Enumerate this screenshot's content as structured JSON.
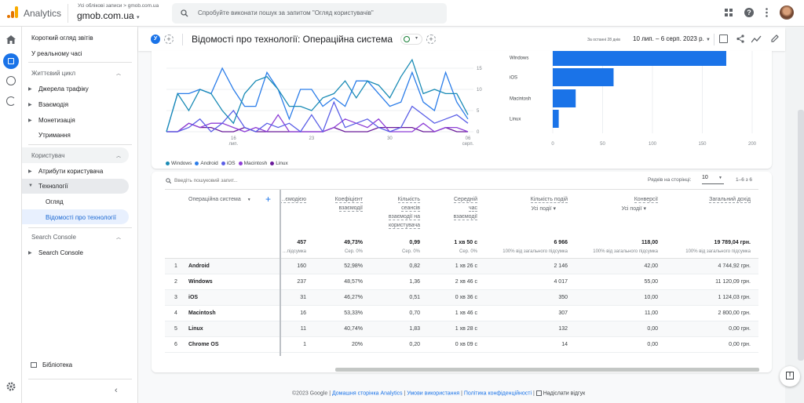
{
  "header": {
    "app_name": "Analytics",
    "breadcrumb": "Усі облікові записи > gmob.com.ua",
    "property": "gmob.com.ua",
    "search_placeholder": "Спробуйте виконати пошук за запитом \"Огляд користувачів\"",
    "icons": [
      "apps-icon",
      "help-icon",
      "more-vert-icon",
      "avatar"
    ]
  },
  "sidebar": {
    "top_items": [
      "Короткий огляд звітів",
      "У реальному часі"
    ],
    "sections": [
      {
        "title": "Життєвий цикл",
        "items": [
          {
            "label": "Джерела трафіку",
            "expandable": true
          },
          {
            "label": "Взаємодія",
            "expandable": true
          },
          {
            "label": "Монетизація",
            "expandable": true
          },
          {
            "label": "Утримання",
            "expandable": false
          }
        ]
      },
      {
        "title": "Користувач",
        "items": [
          {
            "label": "Атрибути користувача",
            "expandable": true
          },
          {
            "label": "Технології",
            "expanded": true
          },
          {
            "label": "Огляд",
            "child": true
          },
          {
            "label": "Відомості про технології",
            "child": true,
            "active": true
          }
        ]
      },
      {
        "title": "Search Console",
        "items": [
          {
            "label": "Search Console",
            "expandable": true
          }
        ]
      }
    ],
    "library": "Бібліотека"
  },
  "report": {
    "segment_badge": "У",
    "title": "Відомості про технології: Операційна система",
    "date_label": "За останні 28 днів",
    "date_range": "10 лип. – 6 серп. 2023 р."
  },
  "chart_data": [
    {
      "type": "line",
      "x": [
        "10.07",
        "11.07",
        "12.07",
        "13.07",
        "14.07",
        "15.07",
        "16.07",
        "17.07",
        "18.07",
        "19.07",
        "20.07",
        "21.07",
        "22.07",
        "23.07",
        "24.07",
        "25.07",
        "26.07",
        "27.07",
        "28.07",
        "29.07",
        "30.07",
        "31.07",
        "01.08",
        "02.08",
        "03.08",
        "04.08",
        "05.08",
        "06.08"
      ],
      "xticks": [
        {
          "label": "16",
          "sub": "лип.",
          "at": "16.07"
        },
        {
          "label": "23",
          "sub": "",
          "at": "23.07"
        },
        {
          "label": "30",
          "sub": "",
          "at": "30.07"
        },
        {
          "label": "06",
          "sub": "серп.",
          "at": "06.08"
        }
      ],
      "yticks": [
        0,
        5,
        10,
        15
      ],
      "ylim": [
        0,
        18
      ],
      "grid": true,
      "legend": "bottom",
      "series": [
        {
          "name": "Windows",
          "color": "#1a8bb5",
          "values": [
            0,
            9,
            5,
            10,
            9,
            5,
            2,
            9,
            12,
            13,
            10,
            6,
            6,
            5,
            8,
            9,
            12,
            8,
            12,
            11,
            8,
            13,
            17,
            9,
            10,
            9,
            9,
            4
          ]
        },
        {
          "name": "Android",
          "color": "#2b7de9",
          "values": [
            0,
            9,
            9,
            10,
            9,
            15,
            10,
            6,
            6,
            14,
            10,
            3,
            10,
            10,
            6,
            8,
            6,
            12,
            12,
            9,
            6,
            7,
            14,
            7,
            5,
            14,
            7,
            3
          ]
        },
        {
          "name": "iOS",
          "color": "#5a5ee6",
          "values": [
            0,
            0,
            1,
            3,
            0,
            2,
            5,
            1,
            0,
            2,
            1,
            2,
            0,
            4,
            0,
            7,
            1,
            2,
            3,
            1,
            0,
            1,
            6,
            4,
            2,
            3,
            4,
            2
          ]
        },
        {
          "name": "Macintosh",
          "color": "#8e3fd6",
          "values": [
            0,
            0,
            2,
            1,
            2,
            2,
            1,
            0,
            1,
            0,
            4,
            0,
            0,
            0,
            0,
            1,
            3,
            2,
            1,
            3,
            0,
            0,
            0,
            2,
            0,
            1,
            1,
            0
          ]
        },
        {
          "name": "Linux",
          "color": "#6a1b9a",
          "values": [
            0,
            0,
            2,
            1,
            1,
            0,
            0,
            1,
            0,
            0,
            0,
            0,
            0,
            0,
            0,
            1,
            0,
            0,
            0,
            1,
            1,
            1,
            1,
            0,
            0,
            1,
            0,
            0
          ]
        }
      ]
    },
    {
      "type": "bar",
      "orientation": "horizontal",
      "categories": [
        "Windows",
        "iOS",
        "Macintosh",
        "Linux"
      ],
      "values": [
        174,
        61,
        23,
        6
      ],
      "xticks": [
        0,
        50,
        100,
        150,
        200
      ],
      "xlim": [
        0,
        200
      ],
      "color": "#1a73e8",
      "grid": true
    }
  ],
  "table": {
    "search_placeholder": "Введіть пошуковий запит...",
    "rows_per_page_label": "Рядків на сторінці:",
    "rows_per_page": "10",
    "pagination": "1–6 з 6",
    "dimension_header": "Операційна система",
    "columns": [
      {
        "lines": [
          "…ємодією"
        ]
      },
      {
        "lines": [
          "Коефіцієнт",
          "взаємодії"
        ]
      },
      {
        "lines": [
          "Кількість",
          "сеансів",
          "взаємодії на",
          "користувача"
        ]
      },
      {
        "lines": [
          "Середній",
          "час",
          "взаємодії"
        ]
      },
      {
        "lines": [
          "Кількість подій"
        ],
        "select": "Усі події"
      },
      {
        "lines": [
          "Конверсії"
        ],
        "select": "Усі події"
      },
      {
        "lines": [
          "Загальний дохід"
        ]
      }
    ],
    "totals": [
      "457",
      "49,73%",
      "0,99",
      "1 хв 50 с",
      "6 966",
      "118,00",
      "19 789,04 грн."
    ],
    "totals_sub": [
      "…підсумка",
      "Сер. 0%",
      "Сер. 0%",
      "Сер. 0%",
      "100% від загального підсумка",
      "100% від загального підсумка",
      "100% від загального підсумка"
    ],
    "rows": [
      {
        "rank": "1",
        "name": "Android",
        "values": [
          "160",
          "52,98%",
          "0,82",
          "1 хв 26 с",
          "2 146",
          "42,00",
          "4 744,92 грн."
        ]
      },
      {
        "rank": "2",
        "name": "Windows",
        "values": [
          "237",
          "48,57%",
          "1,36",
          "2 хв 46 с",
          "4 017",
          "55,00",
          "11 120,09 грн."
        ]
      },
      {
        "rank": "3",
        "name": "iOS",
        "values": [
          "31",
          "46,27%",
          "0,51",
          "0 хв 36 с",
          "350",
          "10,00",
          "1 124,03 грн."
        ]
      },
      {
        "rank": "4",
        "name": "Macintosh",
        "values": [
          "16",
          "53,33%",
          "0,70",
          "1 хв 46 с",
          "307",
          "11,00",
          "2 800,00 грн."
        ]
      },
      {
        "rank": "5",
        "name": "Linux",
        "values": [
          "11",
          "40,74%",
          "1,83",
          "1 хв 28 с",
          "132",
          "0,00",
          "0,00 грн."
        ]
      },
      {
        "rank": "6",
        "name": "Chrome OS",
        "values": [
          "1",
          "20%",
          "0,20",
          "0 хв 09 с",
          "14",
          "0,00",
          "0,00 грн."
        ]
      }
    ]
  },
  "annotation": {
    "arrow_color": "#e8141c"
  },
  "footer": {
    "copyright": "©2023 Google |",
    "links": [
      "Домашня сторінка Analytics",
      "Умови використання",
      "Політика конфіденційності"
    ],
    "feedback": "Надіслати відгук"
  }
}
